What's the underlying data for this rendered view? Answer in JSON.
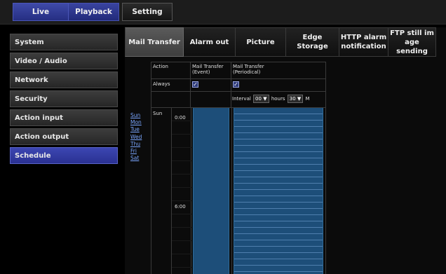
{
  "top_nav": {
    "live_label": "Live",
    "playback_label": "Playback",
    "setting_label": "Setting"
  },
  "sidebar": {
    "items": [
      {
        "label": "System"
      },
      {
        "label": "Video / Audio"
      },
      {
        "label": "Network"
      },
      {
        "label": "Security"
      },
      {
        "label": "Action input"
      },
      {
        "label": "Action output"
      },
      {
        "label": "Schedule"
      }
    ]
  },
  "tabs": {
    "mail_transfer": "Mail Transfer",
    "alarm_out": "Alarm out",
    "picture": "Picture",
    "edge_storage": "Edge Storage",
    "http_alarm_line1": "HTTP alarm",
    "http_alarm_line2": "notification",
    "ftp_line1": "FTP still im",
    "ftp_line2": "age sending"
  },
  "days": [
    "Sun",
    "Mon",
    "Tue",
    "Wed",
    "Thu",
    "Fri",
    "Sat"
  ],
  "table": {
    "action_header": "Action",
    "event_header_line1": "Mail Transfer",
    "event_header_line2": "(Event)",
    "periodical_header_line1": "Mail Transfer",
    "periodical_header_line2": "(Periodical)",
    "always_label": "Always",
    "checkmark": "✓",
    "interval_label": "Interval",
    "interval_hours_value": "00",
    "hours_label": "hours",
    "interval_minutes_value": "30",
    "minutes_label": "M",
    "day_label": "Sun",
    "time_0": "0:00",
    "time_6": "6:00"
  },
  "colors": {
    "accent_blue": "#2a3192",
    "schedule_fill": "#1d4e79",
    "link": "#7aa6ff"
  }
}
